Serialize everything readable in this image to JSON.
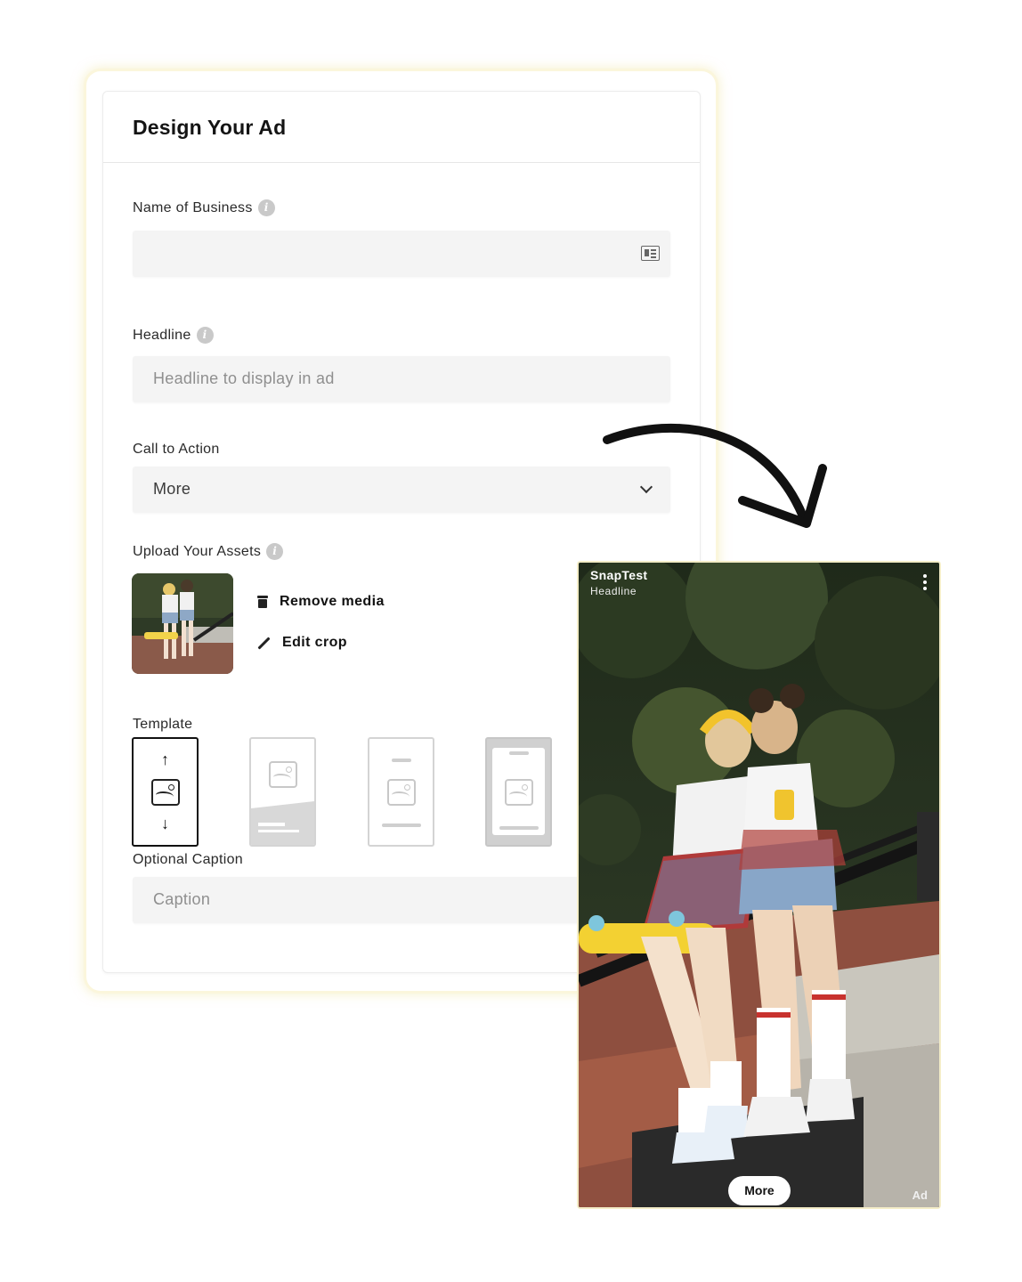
{
  "form": {
    "title": "Design Your Ad",
    "business_label": "Name of Business",
    "business_value": "",
    "headline_label": "Headline",
    "headline_placeholder": "Headline to display in ad",
    "cta_label": "Call to Action",
    "cta_value": "More",
    "upload_label": "Upload Your Assets",
    "remove_media": "Remove media",
    "edit_crop": "Edit crop",
    "template_label": "Template",
    "caption_label": "Optional Caption",
    "caption_placeholder": "Caption",
    "info_glyph": "i"
  },
  "preview": {
    "brand": "SnapTest",
    "headline": "Headline",
    "cta": "More",
    "ad_tag": "Ad"
  },
  "icons": [
    "info-icon",
    "contact-card-icon",
    "chevron-down-icon",
    "trash-icon",
    "pencil-icon",
    "image-icon",
    "arrow-up-icon",
    "arrow-down-icon",
    "kebab-menu-icon",
    "curved-arrow-icon"
  ]
}
